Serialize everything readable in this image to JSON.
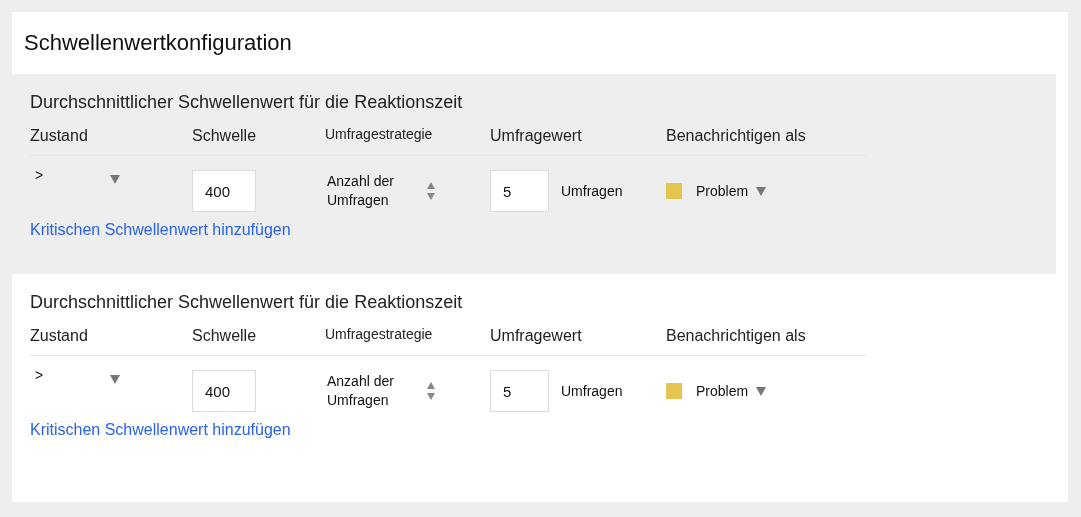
{
  "title": "Schwellenwertkonfiguration",
  "sections": [
    {
      "highlighted": true,
      "heading": "Durchschnittlicher Schwellenwert für die Reaktionszeit",
      "columns": [
        "Zustand",
        "Schwelle",
        "Umfragestrategie",
        "Umfragewert",
        "Benachrichtigen als"
      ],
      "condition": ">",
      "threshold": "400",
      "strategy": "Anzahl der Umfragen",
      "poll_value": "5",
      "poll_unit": "Umfragen",
      "notify": {
        "label": "Problem",
        "color": "#e3c54f"
      },
      "link": "Kritischen Schwellenwert hinzufügen"
    },
    {
      "highlighted": false,
      "heading": "Durchschnittlicher Schwellenwert für die Reaktionszeit",
      "columns": [
        "Zustand",
        "Schwelle",
        "Umfragestrategie",
        "Umfragewert",
        "Benachrichtigen als"
      ],
      "condition": ">",
      "threshold": "400",
      "strategy": "Anzahl der Umfragen",
      "poll_value": "5",
      "poll_unit": "Umfragen",
      "notify": {
        "label": "Problem",
        "color": "#e3c54f"
      },
      "link": "Kritischen Schwellenwert hinzufügen"
    }
  ]
}
